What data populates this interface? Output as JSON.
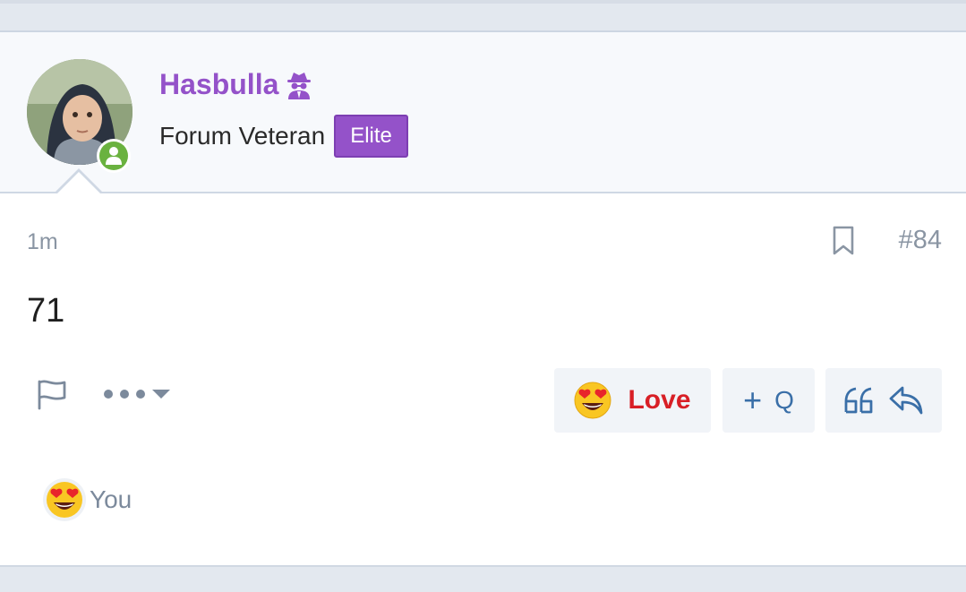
{
  "post": {
    "user": {
      "name": "Hasbulla",
      "title": "Forum Veteran",
      "badge": "Elite",
      "online": true
    },
    "time": "1m",
    "number": "#84",
    "body": "71"
  },
  "actions": {
    "love_label": "Love",
    "multiquote_label": "Q",
    "multiquote_plus": "+"
  },
  "reactions": {
    "by": "You",
    "emoji": "heart-eyes-emoji"
  },
  "colors": {
    "username": "#9452c9",
    "badge": "#9452c9",
    "online": "#6ab23f",
    "love": "#d81f26",
    "action_icon": "#3a6fa8",
    "muted": "#8a95a3"
  }
}
